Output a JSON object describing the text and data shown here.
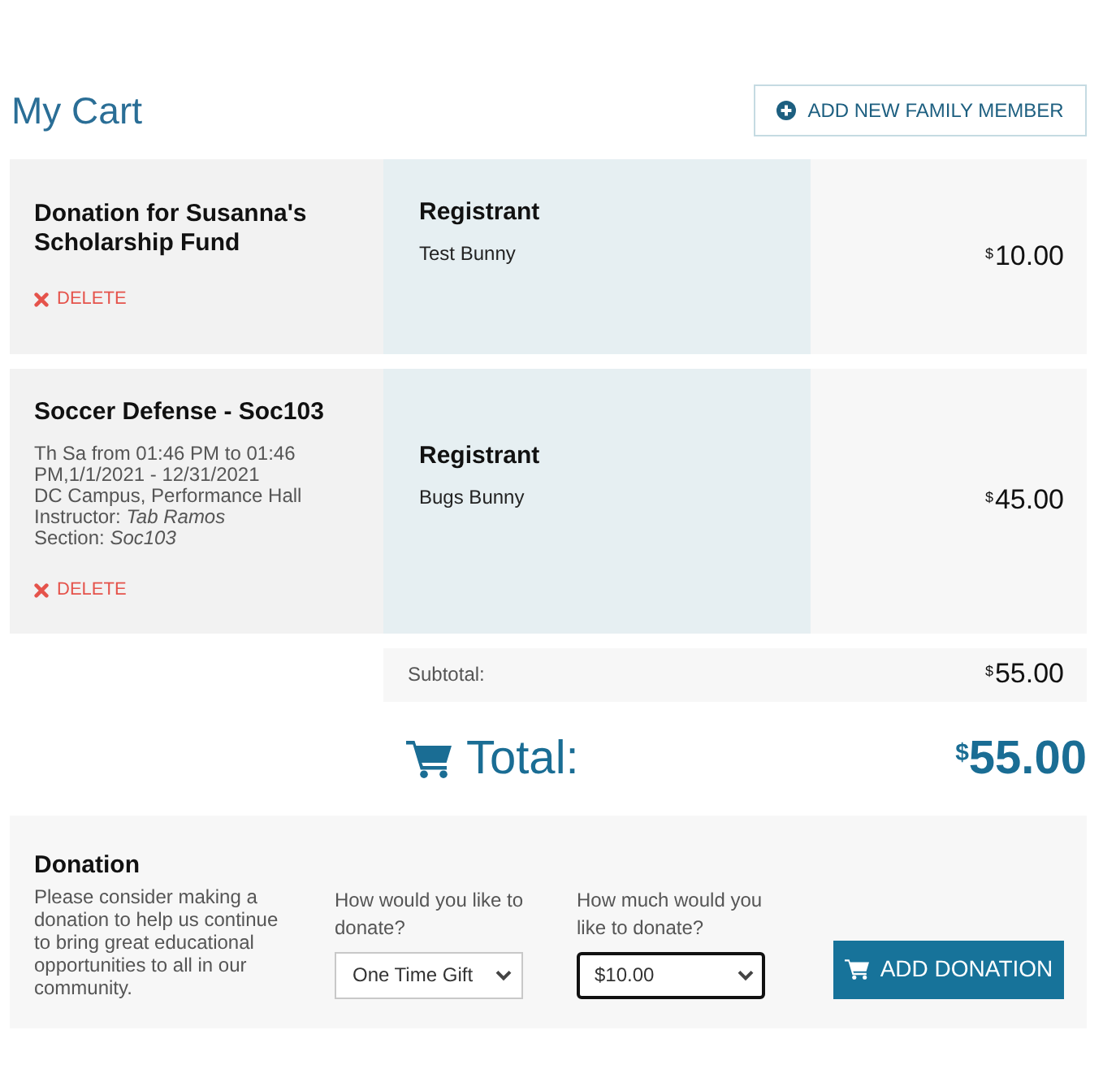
{
  "page": {
    "title": "My Cart"
  },
  "add_family_member_button": {
    "label": "ADD NEW FAMILY MEMBER"
  },
  "cart_items": [
    {
      "title": "Donation for Susanna's Scholarship Fund",
      "delete_label": "DELETE",
      "registrant_heading": "Registrant",
      "registrant_name": "Test Bunny",
      "price": {
        "currency": "$",
        "amount": "10.00"
      }
    },
    {
      "title": "Soccer Defense - Soc103",
      "details": [
        "Th Sa from 01:46 PM to 01:46 PM,1/1/2021 - 12/31/2021",
        "DC Campus, Performance Hall",
        "Instructor: *Tab Ramos*",
        "Section: *Soc103*"
      ],
      "delete_label": "DELETE",
      "registrant_heading": "Registrant",
      "registrant_name": "Bugs Bunny",
      "price": {
        "currency": "$",
        "amount": "45.00"
      }
    }
  ],
  "subtotal": {
    "label": "Subtotal:",
    "currency": "$",
    "amount": "55.00"
  },
  "total": {
    "label": "Total:",
    "currency": "$",
    "amount": "55.00"
  },
  "donation": {
    "title": "Donation",
    "description": "Please consider making a donation to help us continue to bring great educational opportunities to all in our community.",
    "fields": [
      {
        "label": "How would you like to donate?",
        "value": "One Time Gift",
        "focused": false
      },
      {
        "label": "How much would you like to donate?",
        "value": "$10.00",
        "focused": true
      }
    ],
    "button": "ADD DONATION"
  }
}
